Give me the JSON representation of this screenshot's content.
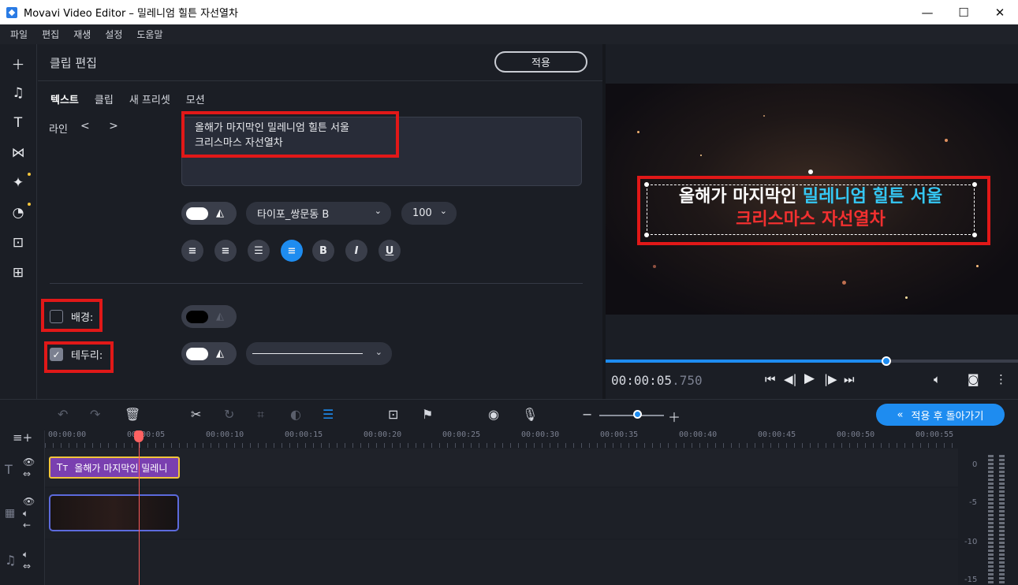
{
  "window": {
    "title": "Movavi Video Editor – 밀레니엄 힐튼 자선열차",
    "minimize": "—",
    "maximize": "☐",
    "close": "✕"
  },
  "menu": [
    "파일",
    "편집",
    "재생",
    "설정",
    "도움말"
  ],
  "sidebar_icons": [
    "add-icon",
    "music-icon",
    "text-icon",
    "transition-icon",
    "magic-icon",
    "sticker-icon",
    "briefcase-icon",
    "apps-icon"
  ],
  "editor": {
    "header": "클립 편집",
    "apply": "적용",
    "tabs": [
      "텍스트",
      "클립",
      "새 프리셋",
      "모션"
    ],
    "line_label": "라인",
    "line_arrows": "< >",
    "text_value": "올해가 마지막인 밀레니엄 힐튼 서울\n크리스마스 자선열차",
    "font_name": "타이포_쌍문동 B",
    "font_size": "100",
    "background_label": "배경:",
    "border_label": "테두리:"
  },
  "preview": {
    "title_line1_a": "올해가 마지막인 ",
    "title_line1_b": "밀레니엄 힐튼 서울",
    "title_line2": "크리스마스 자선열차",
    "time_main": "00:00:05",
    "time_ms": ".750",
    "progress": 0.68
  },
  "toolbar": {
    "back_button": "적용 후 돌아가기"
  },
  "timeline": {
    "ticks": [
      "00:00:00",
      "00:00:05",
      "00:00:10",
      "00:00:15",
      "00:00:20",
      "00:00:25",
      "00:00:30",
      "00:00:35",
      "00:00:40",
      "00:00:45",
      "00:00:50",
      "00:00:55"
    ],
    "title_clip": "올해가 마지막인 밀레니",
    "meter_labels": [
      "0",
      "-5",
      "-10",
      "-15"
    ]
  },
  "colors": {
    "accent": "#1e8cf0",
    "highlight_red": "#e11818",
    "title_cyan": "#35c8f5",
    "title_red": "#f23030"
  }
}
